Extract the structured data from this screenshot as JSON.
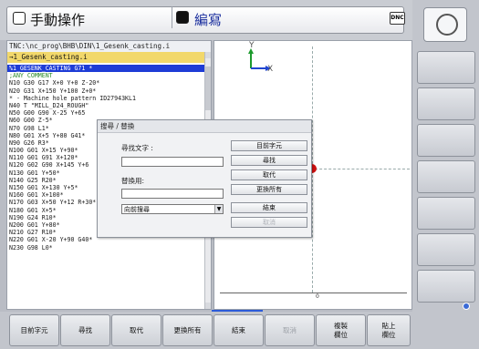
{
  "header": {
    "title": "手動操作",
    "mode": "編寫",
    "dnc_label": "DNC"
  },
  "program": {
    "path": "TNC:\\nc_prog\\BHB\\DIN\\1_Gesenk_casting.i",
    "file": "→1_Gesenk_casting.i",
    "lines": [
      "%1_GESENK_CASTING G71 *",
      ";ANY COMMENT",
      "N10 G30 G17 X+0 Y+0 Z-20*",
      "N20 G31 X+150 Y+100 Z+0*",
      "* - Machine hole pattern ID27943KL1",
      "N40 T \"MILL_D24_ROUGH\" ",
      "N50 G00 G90 X-25 Y+65",
      "N60 G00 Z-5*",
      "N70 G98 L1*",
      "N80 G01 X+5 Y+80 G41*",
      "N90 G26 R3*",
      "N100 G01 X+15 Y+90*",
      "N110 G01 G91 X+120*",
      "N120 G02 G90 X+145 Y+6",
      "N130 G01 Y+50*",
      "N140 G25 R20*",
      "N150 G01 X+130 Y+5*",
      "N160 G01 X+100*",
      "N170 G03 X+50 Y+12 R+30*",
      "N180 G01 X+5*",
      "N190 G24 R10*",
      "N200 G01 Y+80*",
      "N210 G27 R10*",
      "N220 G01 X-20 Y+90 G40*",
      "N230 G98 L0*"
    ]
  },
  "graphic": {
    "axis_y": "Y",
    "axis_x": "X",
    "ruler_zero": "0"
  },
  "dialog": {
    "title": "搜尋 / 替換",
    "find_label": "尋找文字 :",
    "find_value": "",
    "replace_label": "替換用:",
    "replace_value": "",
    "direction_value": "向前搜尋",
    "buttons": {
      "current_word": "目前字元",
      "find": "尋找",
      "replace": "取代",
      "replace_all": "更換所有",
      "end": "結束",
      "cancel": "取消"
    }
  },
  "softkeys": [
    {
      "label": "目前字元",
      "enabled": true
    },
    {
      "label": "尋找",
      "enabled": true
    },
    {
      "label": "取代",
      "enabled": true
    },
    {
      "label": "更換所有",
      "enabled": true
    },
    {
      "label": "結束",
      "enabled": true
    },
    {
      "label": "取消",
      "enabled": false
    },
    {
      "label": "複製\n欄位",
      "enabled": true
    },
    {
      "label": "貼上\n欄位",
      "enabled": true
    }
  ],
  "colors": {
    "selection": "#1e3cd6",
    "file_bar": "#f2d86b",
    "mode_text": "#1b2f9e"
  }
}
